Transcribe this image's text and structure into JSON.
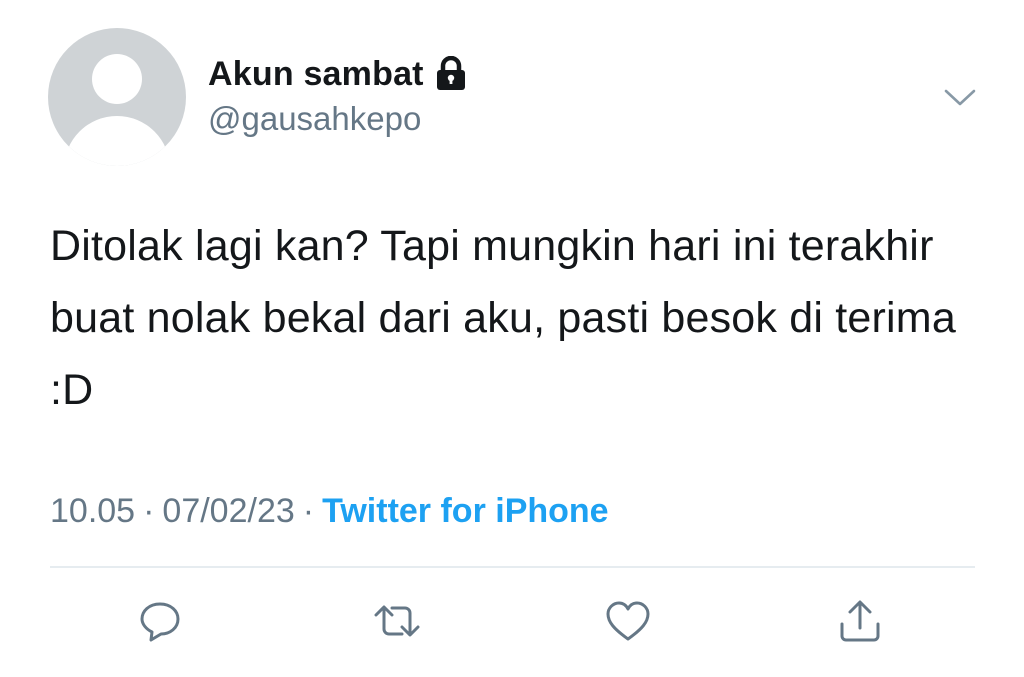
{
  "user": {
    "display_name": "Akun sambat",
    "handle": "@gausahkepo",
    "protected_icon": "lock-icon",
    "avatar_icon": "default-avatar-icon"
  },
  "tweet": {
    "text": "Ditolak lagi kan? Tapi mungkin hari ini terakhir buat nolak bekal dari aku, pasti besok di terima :D",
    "time": "10.05",
    "separator": "·",
    "date": "07/02/23",
    "source": "Twitter for iPhone"
  },
  "menu": {
    "icon": "chevron-down-icon"
  },
  "actions": [
    {
      "name": "reply",
      "icon": "reply-icon"
    },
    {
      "name": "retweet",
      "icon": "retweet-icon"
    },
    {
      "name": "like",
      "icon": "heart-icon"
    },
    {
      "name": "share",
      "icon": "share-icon"
    }
  ],
  "colors": {
    "text": "#14171a",
    "secondary": "#657786",
    "link": "#1da1f2",
    "icon": "#657786",
    "divider": "#e6ecf0",
    "avatar_bg": "#cfd3d6"
  }
}
